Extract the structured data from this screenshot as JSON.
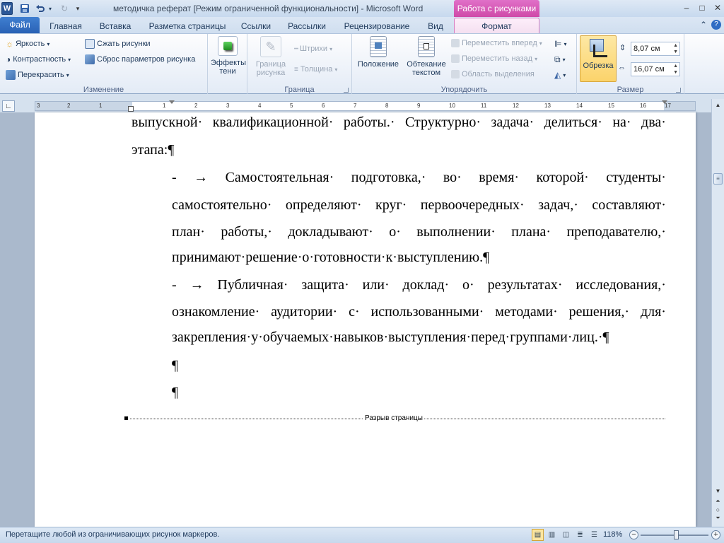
{
  "window": {
    "title": "методичка реферат [Режим ограниченной функциональности]  -  Microsoft Word",
    "context_tab_group": "Работа с рисунками",
    "app_icon": "W"
  },
  "tabs": {
    "file": "Файл",
    "items": [
      "Главная",
      "Вставка",
      "Разметка страницы",
      "Ссылки",
      "Рассылки",
      "Рецензирование",
      "Вид"
    ],
    "format": "Формат"
  },
  "ribbon": {
    "adjust": {
      "label": "Изменение",
      "brightness": "Яркость",
      "contrast": "Контрастность",
      "recolor": "Перекрасить",
      "compress": "Сжать рисунки",
      "reset": "Сброс параметров рисунка"
    },
    "shadow": {
      "line1": "Эффекты",
      "line2": "тени"
    },
    "border": {
      "label": "Граница",
      "line1": "Граница",
      "line2": "рисунка",
      "dashes": "Штрихи",
      "weight": "Толщина"
    },
    "arrange": {
      "label": "Упорядочить",
      "position": "Положение",
      "wrap1": "Обтекание",
      "wrap2": "текстом",
      "forward": "Переместить вперед",
      "backward": "Переместить назад",
      "selection": "Область выделения"
    },
    "size": {
      "label": "Размер",
      "crop": "Обрезка",
      "height": "8,07 см",
      "width": "16,07 см"
    }
  },
  "ruler": {
    "numbers": [
      "3",
      "2",
      "1",
      "1",
      "2",
      "3",
      "4",
      "5",
      "6",
      "7",
      "8",
      "9",
      "10",
      "11",
      "12",
      "13",
      "14",
      "15",
      "16",
      "17"
    ]
  },
  "document": {
    "lines": [
      [
        "выпускной·",
        "квалификационной·",
        "работы.·",
        "Структурно·",
        "задача·",
        "делиться·",
        "на·",
        "два·"
      ],
      [
        "этапа:¶"
      ],
      [
        "-",
        "→",
        "Самостоятельная·",
        "подготовка,·",
        "во·",
        "время·",
        "которой·",
        "студенты·"
      ],
      [
        "самостоятельно·",
        "определяют·",
        "круг·",
        "первоочередных·",
        "задач,·",
        "составляют·"
      ],
      [
        "план·",
        "работы,·",
        "докладывают·",
        "о·",
        "выполнении·",
        "плана·",
        "преподавателю,·"
      ],
      [
        "принимают·решение·о·готовности·к·выступлению.¶"
      ],
      [
        "-",
        "→",
        "Публичная·",
        "защита·",
        "или·",
        "доклад·",
        "о·",
        "результатах·",
        "исследования,·"
      ],
      [
        "ознакомление·",
        "аудитории·",
        "с·",
        "использованными·",
        "методами·",
        "решения,·",
        "для·"
      ],
      [
        "закрепления·у·обучаемых·навыков·выступления·перед·группами·лиц.·¶"
      ],
      [
        "¶"
      ],
      [
        "¶"
      ]
    ],
    "page_break": "Разрыв страницы"
  },
  "status": {
    "message": "Перетащите любой из ограничивающих рисунок маркеров.",
    "zoom": "118%",
    "zoom_level_percent": 118
  },
  "colors": {
    "accent": "#2a62b5",
    "context": "#cf4aa8",
    "crop_active": "#fbd36b"
  }
}
